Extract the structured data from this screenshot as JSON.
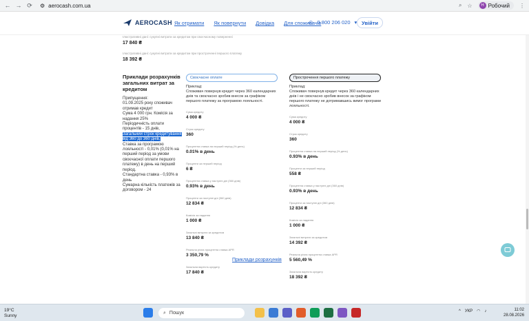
{
  "browser": {
    "url": "aerocash.com.ua",
    "profile_label": "Робочий",
    "profile_initial": "Н"
  },
  "header": {
    "logo_text": "AEROCASH",
    "menu": [
      "Як отримати",
      "Як повернути",
      "Довідка",
      "Для споживачів"
    ],
    "phone": "0 800 206 020",
    "login_label": "Увійти"
  },
  "top_section": {
    "note1": "Ілюстративні дані: сукупні витрати за кредитом при своєчасному поверненні",
    "value1": "17 840 ₴",
    "note2": "Ілюстративні дані: сукупні витрати за кредитом при простроченні першого платежу",
    "value2": "18 392 ₴"
  },
  "left": {
    "title": "Приклади розрахунків загальних витрат за кредитом",
    "pre": "Припущення:\n01.09.2025 року споживач отримав кредит\nСума 4 000 грн. Комісія за надання 25%\nПеріодичність оплати процентів - 15 днів,",
    "highlight": "Загальний строк кредитування від 360 до 360 днів,",
    "post": "Ставка за програмою лояльності - 0,01% (0,01% на перший період за умови своєчасної оплати першого платежу) в день на перший період.\nСтандартна ставка - 0,93% в день\nСумарна кількість платежів за договором - 24"
  },
  "columns": [
    {
      "tab": "Своєчасне оплате",
      "example": "Приклад:\nСпоживач повернув кредит через 360 календарних днів та своєчасно зробив внесок за графіком першого платежу за програмою лояльності.",
      "rows": [
        {
          "label": "Сума кредиту",
          "value": "4 000 ₴"
        },
        {
          "label": "Строк кредиту",
          "value": "360"
        },
        {
          "label": "Процентна ставка на перший період (% день)",
          "value": "0.01% в день"
        },
        {
          "label": "Проценти за перший період",
          "value": "6 ₴"
        },
        {
          "label": "Процентна ставка у наступні дні (360 днів)",
          "value": "0.93% в день"
        },
        {
          "label": "Проценти за наступні дні (360 днів)",
          "value": "12 834 ₴"
        },
        {
          "label": "Комісія за надання",
          "value": "1 000 ₴"
        },
        {
          "label": "Загальні витрати за кредитом",
          "value": "13 840 ₴"
        },
        {
          "label": "Реальна річна процентна ставка APR",
          "value": "3 350,79 %"
        },
        {
          "label": "Загальна вартість кредиту",
          "value": "17 840 ₴"
        }
      ]
    },
    {
      "tab": "Прострочення першого платежу",
      "example": "Приклад:\nСпоживач повернув кредит через 360 календарних днів і не своєчасно зробив внесок за графіком першого платежу не дотримавшись вимог програми лояльності.",
      "rows": [
        {
          "label": "Сума кредиту",
          "value": "4 000 ₴"
        },
        {
          "label": "Строк кредиту",
          "value": "360"
        },
        {
          "label": "Процентна ставка на перший період (% день)",
          "value": "0.93% в день"
        },
        {
          "label": "Проценти за перший період",
          "value": "558 ₴"
        },
        {
          "label": "Процентна ставка у наступні дні (360 днів)",
          "value": "0.93% в день"
        },
        {
          "label": "Проценти за наступні дні (360 днів)",
          "value": "12 834 ₴"
        },
        {
          "label": "Комісія за надання",
          "value": "1 000 ₴"
        },
        {
          "label": "Загальні витрати за кредитом",
          "value": "14 392 ₴"
        },
        {
          "label": "Реальна річна процентна ставка APR",
          "value": "5 560,49 %"
        },
        {
          "label": "Загальна вартість кредиту",
          "value": "18 392 ₴"
        }
      ]
    }
  ],
  "bottom_link": "Приклади розрахунків",
  "taskbar": {
    "temp": "19°C",
    "weather": "Sunny",
    "search": "Пошук",
    "lang": "УКР",
    "time": "11:02",
    "date": "28.08.2026"
  }
}
